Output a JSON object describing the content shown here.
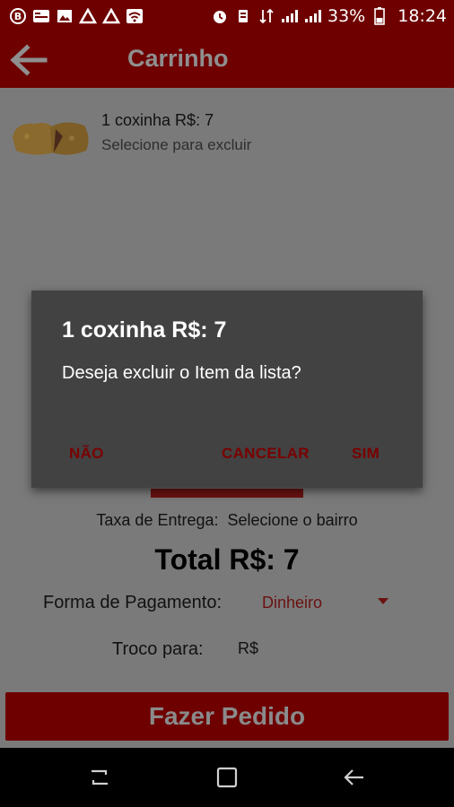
{
  "status_bar": {
    "battery_percent": "33%",
    "time": "18:24",
    "icons": [
      "b-icon",
      "news-icon",
      "image-icon",
      "drive-icon",
      "drive-icon",
      "wifi-alert-icon",
      "alarm-icon",
      "vibrate-icon",
      "data-4g-icon",
      "signal-icon",
      "signal-icon",
      "battery-icon"
    ]
  },
  "app_bar": {
    "title": "Carrinho",
    "back_icon": "arrow-left-icon"
  },
  "cart": {
    "item_name": "1 coxinha  R$: 7",
    "item_hint": "Selecione para excluir"
  },
  "summary": {
    "fee_label": "Taxa de Entrega:",
    "fee_value": "Selecione o bairro",
    "total": "Total R$: 7",
    "payment_label": "Forma de Pagamento:",
    "payment_value": "Dinheiro",
    "change_label": "Troco para:",
    "change_value": "R$"
  },
  "order_button": {
    "label": "Fazer Pedido"
  },
  "dialog": {
    "title": "1 coxinha  R$: 7",
    "message": "Deseja excluir o Item da lista?",
    "btn_no": "NÃO",
    "btn_cancel": "CANCELAR",
    "btn_yes": "SIM"
  },
  "colors": {
    "primary_dark": "#6e0000",
    "dialog_bg": "#424242",
    "dialog_button": "#7a0000",
    "dim_bg": "#7a7a7a"
  }
}
